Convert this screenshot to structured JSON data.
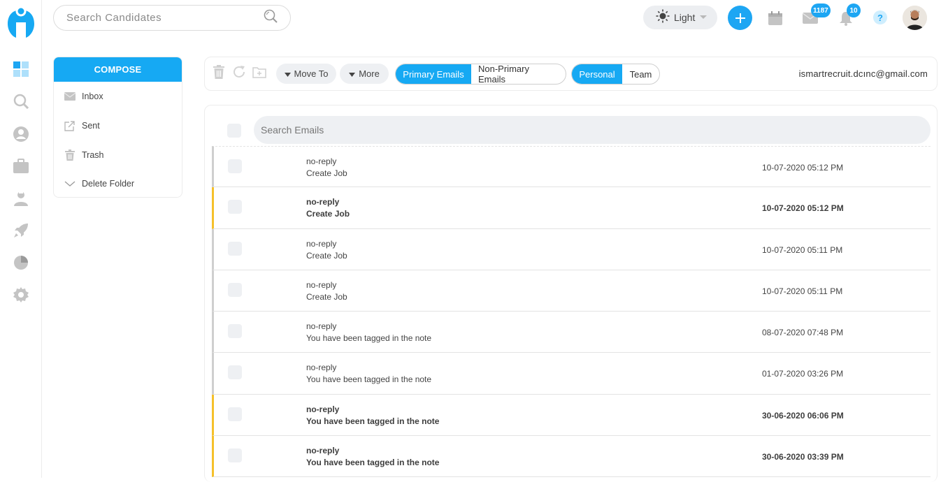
{
  "colors": {
    "accent": "#16a9f3",
    "unread_marker": "#f5c02a",
    "read_marker": "#cfcfcf"
  },
  "header": {
    "search_placeholder": "Search Candidates",
    "theme_label": "Light",
    "mail_badge": "1187",
    "notification_badge": "10",
    "help_label": "?"
  },
  "sidebar": {
    "icons": [
      "dashboard-icon",
      "search-icon",
      "user-icon",
      "briefcase-icon",
      "recruiter-icon",
      "rocket-icon",
      "pie-chart-icon",
      "gear-icon"
    ]
  },
  "folders": {
    "compose_label": "COMPOSE",
    "items": [
      {
        "label": "Inbox",
        "icon": "envelope-icon"
      },
      {
        "label": "Sent",
        "icon": "external-link-icon"
      },
      {
        "label": "Trash",
        "icon": "trash-icon"
      },
      {
        "label": "Delete Folder",
        "icon": "chevron-down-icon"
      }
    ]
  },
  "toolbar": {
    "move_to_label": "Move To",
    "more_label": "More",
    "primary_label": "Primary Emails",
    "non_primary_label": "Non-Primary Emails",
    "personal_label": "Personal",
    "team_label": "Team",
    "account_email": "ismartrecruit.dcınc@gmail.com"
  },
  "email_list": {
    "search_placeholder": "Search Emails",
    "rows": [
      {
        "sender": "no-reply",
        "subject": "Create Job",
        "date": "10-07-2020 05:12 PM",
        "unread": false
      },
      {
        "sender": "no-reply",
        "subject": "Create Job",
        "date": "10-07-2020 05:12 PM",
        "unread": true
      },
      {
        "sender": "no-reply",
        "subject": "Create Job",
        "date": "10-07-2020 05:11 PM",
        "unread": false
      },
      {
        "sender": "no-reply",
        "subject": "Create Job",
        "date": "10-07-2020 05:11 PM",
        "unread": false
      },
      {
        "sender": "no-reply",
        "subject": "You have been tagged in the note",
        "date": "08-07-2020 07:48 PM",
        "unread": false
      },
      {
        "sender": "no-reply",
        "subject": "You have been tagged in the note",
        "date": "01-07-2020 03:26 PM",
        "unread": false
      },
      {
        "sender": "no-reply",
        "subject": "You have been tagged in the note",
        "date": "30-06-2020 06:06 PM",
        "unread": true
      },
      {
        "sender": "no-reply",
        "subject": "You have been tagged in the note",
        "date": "30-06-2020 03:39 PM",
        "unread": true
      }
    ]
  }
}
